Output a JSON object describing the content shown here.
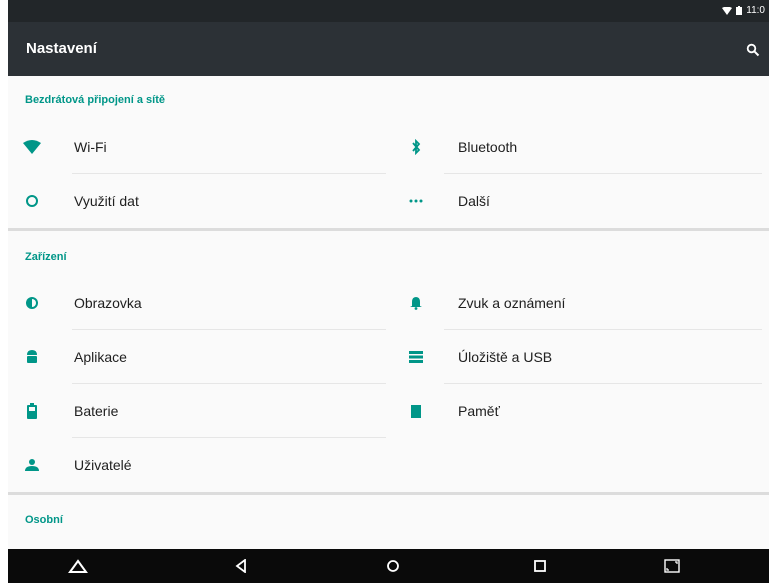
{
  "status": {
    "time": "11:0"
  },
  "app": {
    "title": "Nastavení"
  },
  "sections": {
    "wireless": {
      "title": "Bezdrátová připojení a sítě",
      "items": {
        "wifi": "Wi-Fi",
        "bluetooth": "Bluetooth",
        "data": "Využití dat",
        "more": "Další"
      }
    },
    "device": {
      "title": "Zařízení",
      "items": {
        "display": "Obrazovka",
        "sound": "Zvuk a oznámení",
        "apps": "Aplikace",
        "storage": "Úložiště a USB",
        "battery": "Baterie",
        "memory": "Paměť",
        "users": "Uživatelé"
      }
    },
    "personal": {
      "title": "Osobní"
    }
  },
  "colors": {
    "accent": "#009688",
    "appbar": "#2c3136",
    "statusbar": "#222629",
    "navbar": "#0a0a0a"
  },
  "icons": {
    "search": "search-icon",
    "wifi": "wifi-icon",
    "bluetooth": "bluetooth-icon",
    "data": "data-usage-icon",
    "more": "more-icon",
    "display": "brightness-icon",
    "sound": "bell-icon",
    "apps": "android-icon",
    "storage": "storage-icon",
    "battery": "battery-icon",
    "memory": "memory-icon",
    "users": "person-icon"
  }
}
